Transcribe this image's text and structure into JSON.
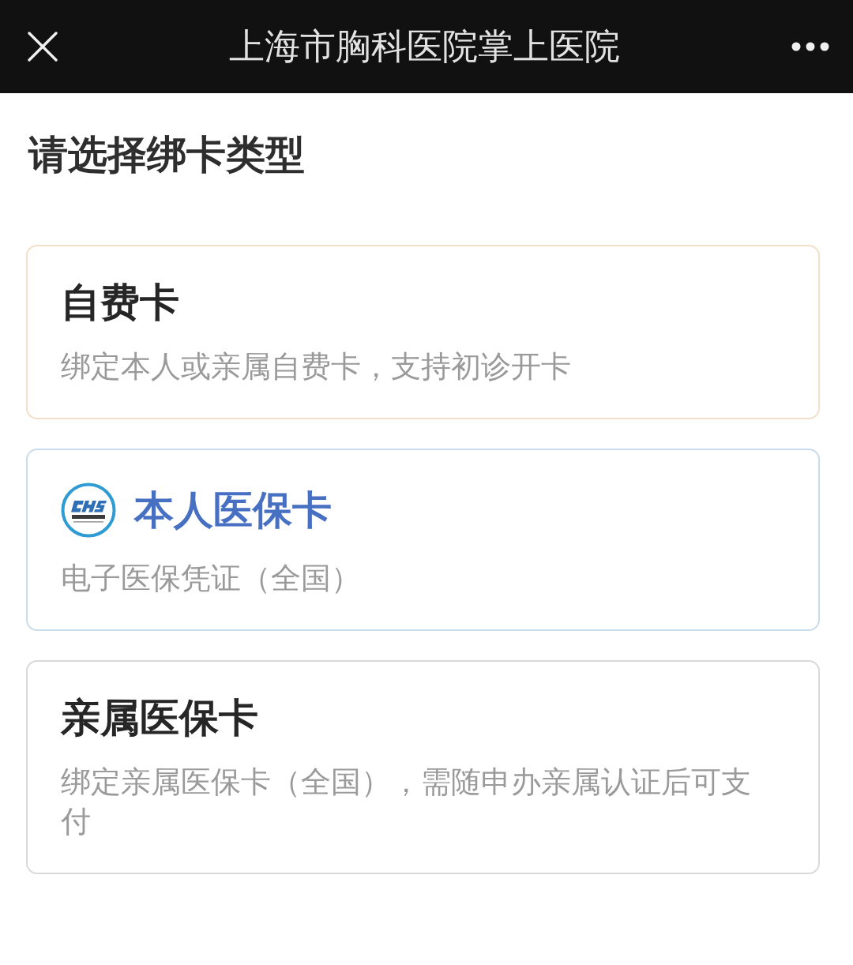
{
  "window": {
    "title": "上海市胸科医院掌上医院"
  },
  "page": {
    "heading": "请选择绑卡类型"
  },
  "options": [
    {
      "kind": "plain",
      "title": "自费卡",
      "description": "绑定本人或亲属自费卡，支持初诊开卡",
      "color": "#f2dfc9"
    },
    {
      "kind": "logo",
      "title": "本人医保卡",
      "description": "电子医保凭证（全国）",
      "color": "#c9dcec"
    },
    {
      "kind": "plain",
      "title": "亲属医保卡",
      "description": "绑定亲属医保卡（全国），需随申办亲属认证后可支付",
      "color": "#d9d9d9"
    }
  ]
}
